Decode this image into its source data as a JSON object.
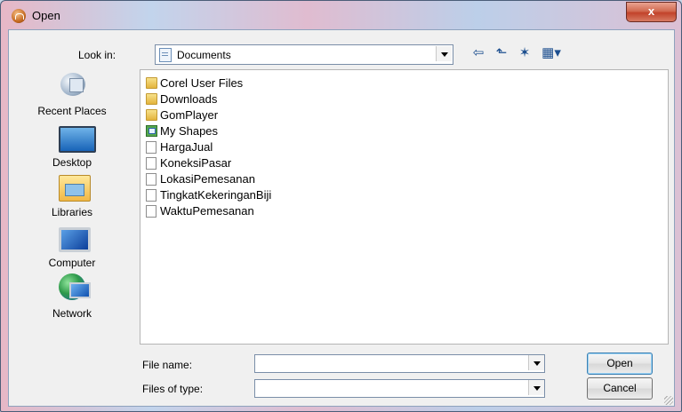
{
  "window": {
    "title": "Open",
    "close_label": "x"
  },
  "toolbar": {
    "look_in_label": "Look in:",
    "look_in_value": "Documents",
    "back_glyph": "⇦",
    "up_glyph": "⬑",
    "new_folder_glyph": "✶",
    "view_glyph": "▦▾"
  },
  "places": [
    {
      "label": "Recent Places",
      "icon": "recent-places-icon"
    },
    {
      "label": "Desktop",
      "icon": "desktop-icon"
    },
    {
      "label": "Libraries",
      "icon": "libraries-icon"
    },
    {
      "label": "Computer",
      "icon": "computer-icon"
    },
    {
      "label": "Network",
      "icon": "network-icon"
    }
  ],
  "files": [
    {
      "name": "Corel User Files",
      "icon": "folder-icon"
    },
    {
      "name": "Downloads",
      "icon": "folder-icon"
    },
    {
      "name": "GomPlayer",
      "icon": "folder-icon"
    },
    {
      "name": "My Shapes",
      "icon": "shapes-folder-icon"
    },
    {
      "name": "HargaJual",
      "icon": "document-icon"
    },
    {
      "name": "KoneksiPasar",
      "icon": "document-icon"
    },
    {
      "name": "LokasiPemesanan",
      "icon": "document-icon"
    },
    {
      "name": "TingkatKekeringanBiji",
      "icon": "document-icon"
    },
    {
      "name": "WaktuPemesanan",
      "icon": "document-icon"
    }
  ],
  "footer": {
    "file_name_label": "File name:",
    "file_name_value": "",
    "file_type_label": "Files of type:",
    "file_type_value": "",
    "open_label": "Open",
    "cancel_label": "Cancel"
  }
}
